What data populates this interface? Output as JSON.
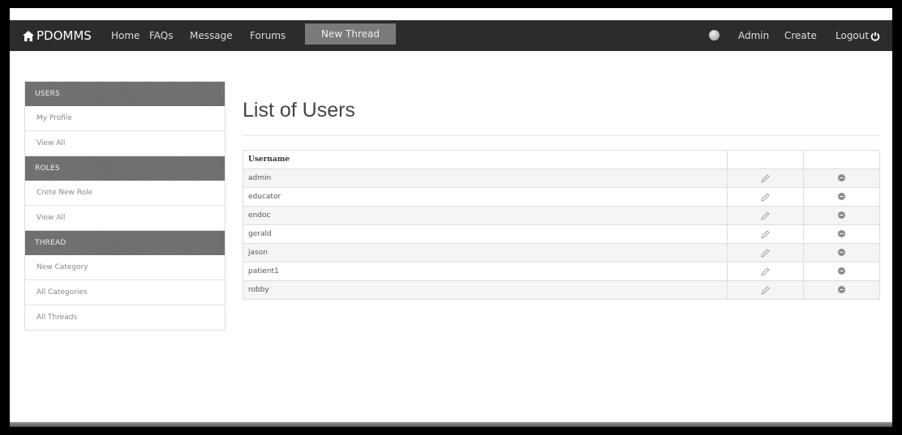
{
  "navbar": {
    "brand": "PDOMMS",
    "links": [
      "Home",
      "FAQs",
      "Message",
      "Forums"
    ],
    "active_tab": "New Thread",
    "right": {
      "admin": "Admin",
      "create": "Create",
      "logout": "Logout"
    }
  },
  "sidebar": {
    "sections": [
      {
        "heading": "USERS",
        "items": [
          "My Profile",
          "View All"
        ]
      },
      {
        "heading": "ROLES",
        "items": [
          "Crete New Role",
          "View All"
        ]
      },
      {
        "heading": "THREAD",
        "items": [
          "New Category",
          "All Categories",
          "All Threads"
        ]
      }
    ]
  },
  "main": {
    "title": "List of Users",
    "table": {
      "header": "Username",
      "rows": [
        "admin",
        "educator",
        "endoc",
        "gerald",
        "jason",
        "patient1",
        "robby"
      ]
    }
  }
}
